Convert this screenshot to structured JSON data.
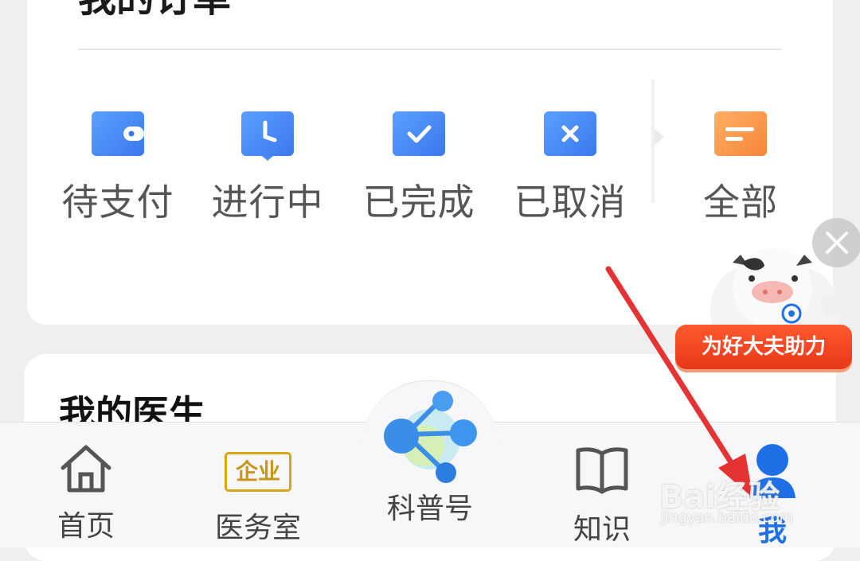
{
  "orders": {
    "title": "我的订单",
    "items": [
      {
        "label": "待支付",
        "icon": "wallet-icon",
        "color": "#4f8ef5"
      },
      {
        "label": "进行中",
        "icon": "clock-icon",
        "color": "#4f8ef5"
      },
      {
        "label": "已完成",
        "icon": "check-icon",
        "color": "#4f8ef5"
      },
      {
        "label": "已取消",
        "icon": "cancel-icon",
        "color": "#4f8ef5"
      },
      {
        "label": "全部",
        "icon": "clipboard-icon",
        "color": "#f6953e"
      }
    ]
  },
  "doctors": {
    "title": "我的医生"
  },
  "promo": {
    "banner": "为好大夫助力"
  },
  "nav": {
    "items": [
      {
        "label": "首页",
        "icon": "home-icon"
      },
      {
        "label": "医务室",
        "icon": "enterprise-icon",
        "badge": "企业"
      },
      {
        "label": "科普号",
        "icon": "share-network-icon"
      },
      {
        "label": "知识",
        "icon": "book-icon"
      },
      {
        "label": "我",
        "icon": "user-icon",
        "active": true,
        "active_color": "#1f6fe6"
      }
    ]
  },
  "watermark": {
    "main": "Bai经验",
    "sub": "jingyan.baidu.com"
  }
}
